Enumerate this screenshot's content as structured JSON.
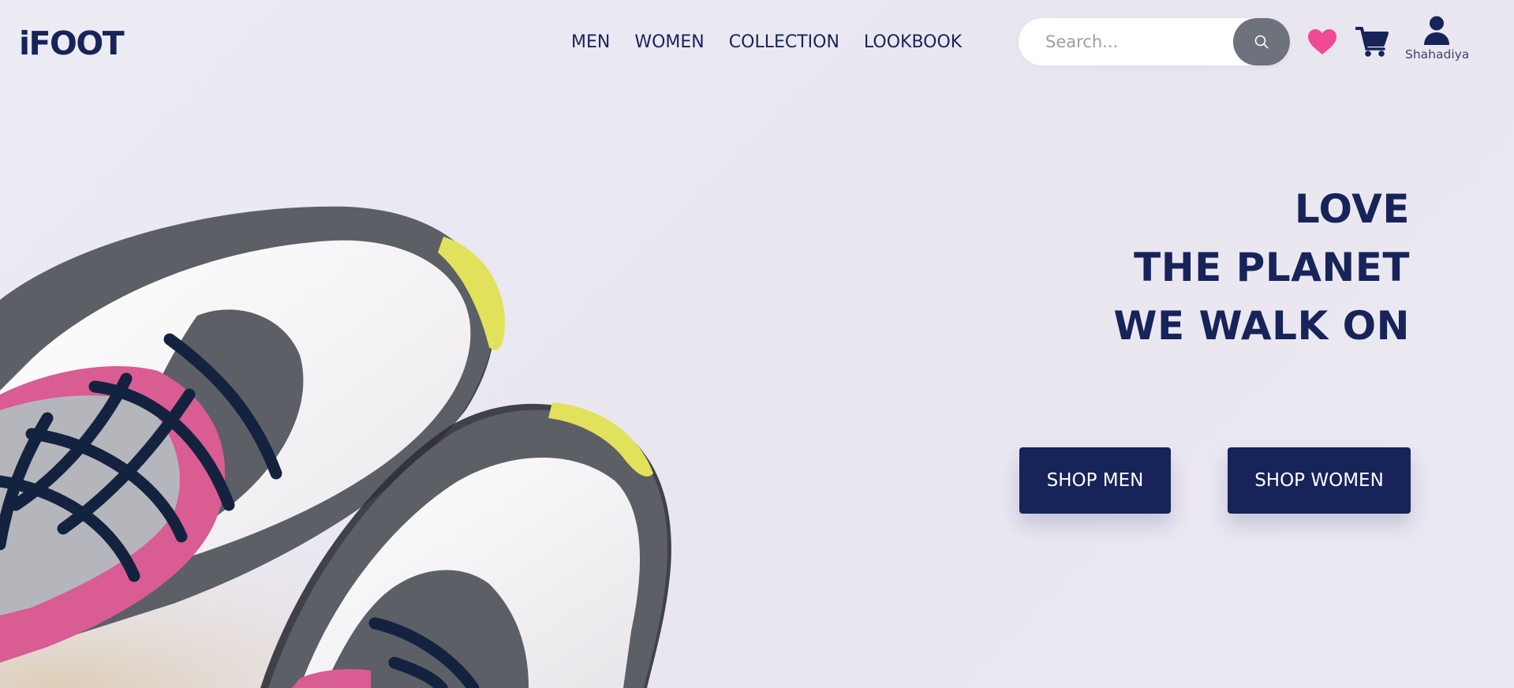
{
  "brand": {
    "logo": "iFOOT"
  },
  "nav": {
    "items": [
      "MEN",
      "WOMEN",
      "COLLECTION",
      "LOOKBOOK"
    ]
  },
  "search": {
    "placeholder": "Search...",
    "value": ""
  },
  "header_icons": [
    "magnifier-icon",
    "heart-icon",
    "cart-icon",
    "user-icon"
  ],
  "user": {
    "name": "Shahadiya"
  },
  "hero": {
    "headline": [
      "LOVE",
      "THE PLANET",
      "WE WALK ON"
    ],
    "buttons": {
      "shop_men": "SHOP MEN",
      "shop_women": "SHOP WOMEN"
    }
  },
  "colors": {
    "navy": "#17245a",
    "pink": "#ee4a95",
    "search_button": "#6d727d",
    "background": "#ebe9f1"
  }
}
